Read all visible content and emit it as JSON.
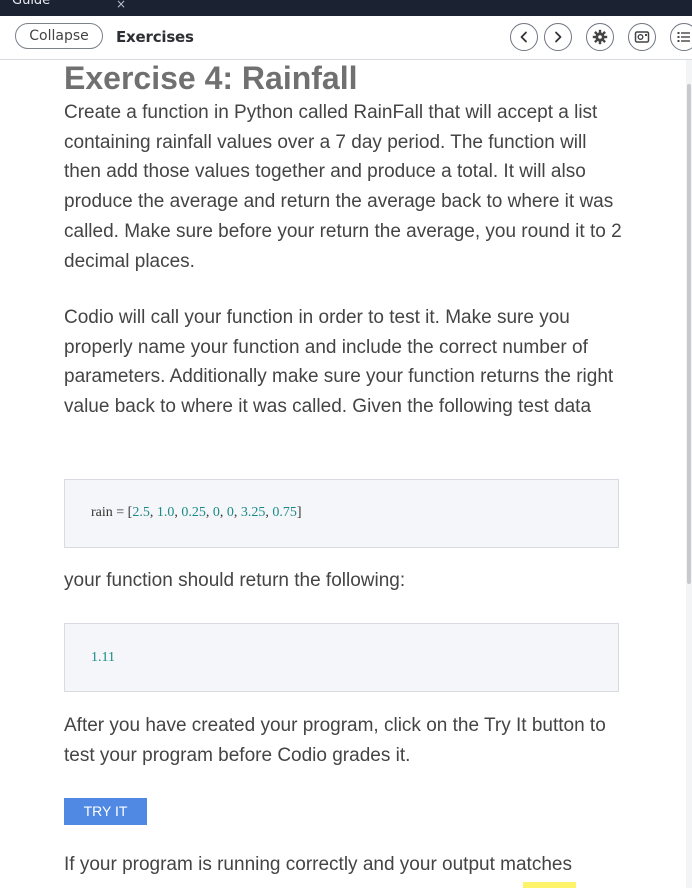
{
  "tab": {
    "title": "Guide",
    "close": "×"
  },
  "toolbar": {
    "collapse_label": "Collapse",
    "title": "Exercises",
    "icons": [
      "chevron-left-icon",
      "chevron-right-icon",
      "gear-icon",
      "image-icon",
      "list-icon"
    ]
  },
  "content": {
    "title": "Exercise 4: Rainfall",
    "para1": "Create a function in Python called RainFall that will accept a list containing rainfall values over a 7 day period. The function will then add those values together and produce a total. It will also produce the average and return the average back to where it was called. Make sure before your return the average, you round it to 2 decimal places.",
    "para2": "Codio will call your function in order to test it. Make sure you properly name your function and include the correct number of parameters. Additionally make sure your function returns the right value back to where it was called. Given the following test data",
    "code1": {
      "prefix": "rain = [",
      "values": [
        "2.5",
        "1.0",
        "0.25",
        "0",
        "0",
        "3.25",
        "0.75"
      ],
      "suffix": "]"
    },
    "para3": "your function should return the following:",
    "code2": "1.11",
    "para4": "After you have created your program, click on the Try It button to test your program before Codio grades it.",
    "try_button": "TRY IT",
    "para5": "If your program is running correctly and your output matches"
  },
  "colors": {
    "tabbar": "#1b2232",
    "number": "#1b8a86",
    "button": "#4f89e3",
    "title": "#707070",
    "text": "#444444"
  }
}
